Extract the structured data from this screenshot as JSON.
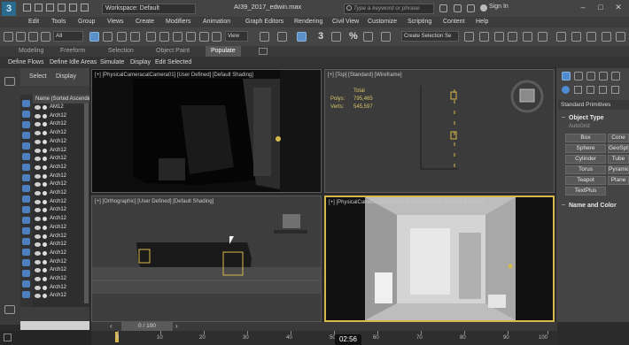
{
  "title_bar": {
    "logo": "3",
    "workspace": "Workspace: Default",
    "filename": "AI39_2017_edwin.max",
    "search_placeholder": "Type a keyword or phrase",
    "sign_in": "Sign In",
    "minimize": "–",
    "maximize": "□",
    "close": "✕"
  },
  "menu": [
    "Edit",
    "Tools",
    "Group",
    "Views",
    "Create",
    "Modifiers",
    "Animation",
    "Graph Editors",
    "Rendering",
    "Civil View",
    "Customize",
    "Scripting",
    "Content",
    "Help"
  ],
  "toolbar": {
    "selection_filter": "All",
    "reference_coord": "View",
    "selection_set": "Create Selection Se",
    "snap_label": "3",
    "percent_label": "%"
  },
  "ribbon_tabs": [
    "Modeling",
    "Freeform",
    "Selection",
    "Object Paint",
    "Populate"
  ],
  "ribbon_active": "Populate",
  "ribbon_subtabs": [
    "Define Flows",
    "Define Idle Areas",
    "Simulate",
    "Display",
    "Edit Selected"
  ],
  "scene_explorer": {
    "tabs": [
      "Select",
      "Display"
    ],
    "column_header": "Name (Sorted Ascending)",
    "rows": [
      "AM12",
      "Arch12",
      "Arch12",
      "Arch12",
      "Arch12",
      "Arch12",
      "Arch12",
      "Arch12",
      "Arch12",
      "Arch12",
      "Arch12",
      "Arch12",
      "Arch12",
      "Arch12",
      "Arch12",
      "Arch12",
      "Arch12",
      "Arch12",
      "Arch12",
      "Arch12",
      "Arch12",
      "Arch12",
      "Arch12",
      "Arch12",
      "Arch12"
    ]
  },
  "viewports": {
    "camera": "[+] [PhysicalCameracalCamera01] [User Defined] [Default Shading]",
    "top": "[+] [Top] [Standard] [Wireframe]",
    "ortho": "[+] [Orthographic] [User Defined] [Default Shading]",
    "camera2": "[+] [PhysicalCameracalCamera01] [Perfomance] [Default Shading]"
  },
  "stats": {
    "total_label": "Total",
    "polys_label": "Polys:",
    "polys_value": "795,465",
    "verts_label": "Verts:",
    "verts_value": "545,597"
  },
  "command_panel": {
    "category": "Standard Primitives",
    "object_type_label": "Object Type",
    "autogrid_label": "AutoGrid",
    "buttons": [
      "Box",
      "Cone",
      "Sphere",
      "GeoSphere",
      "Cylinder",
      "Tube",
      "Torus",
      "Pyramid",
      "Teapot",
      "Plane",
      "TextPlus"
    ],
    "name_color_label": "Name and Color"
  },
  "timeline": {
    "frame_counter": "0 / 100",
    "ticks": [
      "0",
      "10",
      "20",
      "30",
      "40",
      "50",
      "60",
      "70",
      "80",
      "90",
      "100"
    ],
    "time_display": "02:56"
  },
  "colors": {
    "active_viewport_border": "#d5b94a",
    "accent_blue": "#4e8bd0",
    "stats_yellow": "#d9c56a"
  }
}
